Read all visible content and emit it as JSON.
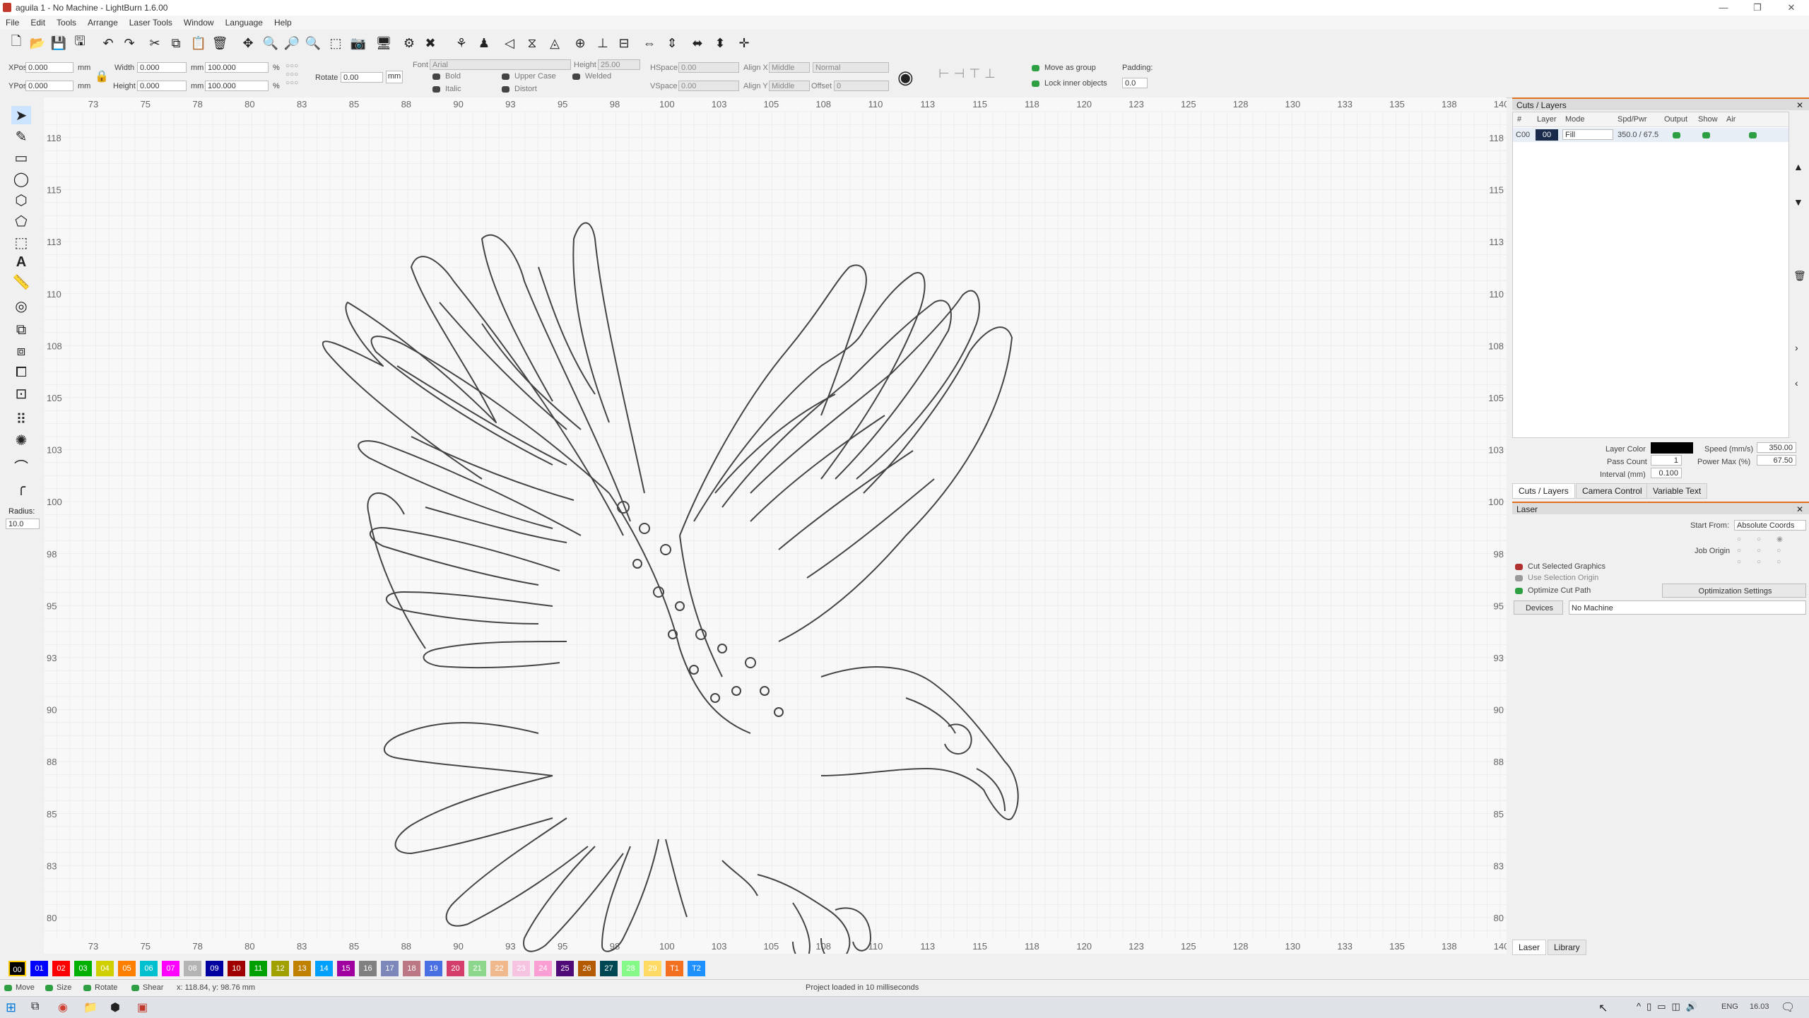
{
  "window": {
    "title": "aguila 1 - No Machine - LightBurn 1.6.00",
    "min": "—",
    "max": "❐",
    "close": "✕"
  },
  "menu": [
    "File",
    "Edit",
    "Tools",
    "Arrange",
    "Laser Tools",
    "Window",
    "Language",
    "Help"
  ],
  "options": {
    "xpos_label": "XPos",
    "xpos": "0.000",
    "ypos_label": "YPos",
    "ypos": "0.000",
    "unit_mm": "mm",
    "width_label": "Width",
    "width": "0.000",
    "height_label": "Height",
    "height": "0.000",
    "scale_w": "100.000",
    "scale_h": "100.000",
    "pct": "%",
    "rotate_label": "Rotate",
    "rotate": "0.00",
    "mm_btn": "mm",
    "font_label": "Font",
    "font": "Arial",
    "height2_label": "Height",
    "height2": "25.00",
    "hspace_label": "HSpace",
    "hspace": "0.00",
    "vspace_label": "VSpace",
    "vspace": "0.00",
    "alignx_label": "Align X",
    "alignx": "Middle",
    "aligny_label": "Align Y",
    "aligny": "Middle",
    "normal": "Normal",
    "offset_label": "Offset",
    "offset": "0",
    "bold": "Bold",
    "italic": "Italic",
    "upper": "Upper Case",
    "distort": "Distort",
    "welded": "Welded",
    "move_group": "Move as group",
    "lock_inner": "Lock inner objects",
    "padding_label": "Padding:",
    "padding": "0.0"
  },
  "left_tools": {
    "radius_label": "Radius:",
    "radius": "10.0"
  },
  "ruler": {
    "x_ticks": [
      "73",
      "75",
      "78",
      "80",
      "83",
      "85",
      "88",
      "90",
      "93",
      "95",
      "98",
      "100",
      "103",
      "105",
      "108",
      "110",
      "113",
      "115",
      "118",
      "120",
      "123",
      "125",
      "128",
      "130",
      "133",
      "135",
      "138",
      "140"
    ],
    "y_ticks": [
      "118",
      "115",
      "113",
      "110",
      "108",
      "105",
      "103",
      "100",
      "98",
      "95",
      "93",
      "90",
      "88",
      "85",
      "83",
      "80"
    ]
  },
  "cuts_panel": {
    "title": "Cuts / Layers",
    "headers": [
      "#",
      "Layer",
      "Mode",
      "Spd/Pwr",
      "Output",
      "Show",
      "Air"
    ],
    "row": {
      "num": "C00",
      "layer": "00",
      "mode": "Fill",
      "spdpwr": "350.0 / 67.5"
    },
    "layer_color_label": "Layer Color",
    "speed_label": "Speed (mm/s)",
    "speed": "350.00",
    "pass_label": "Pass Count",
    "pass": "1",
    "power_label": "Power Max (%)",
    "power": "67.50",
    "interval_label": "Interval (mm)",
    "interval": "0.100",
    "tabs": [
      "Cuts / Layers",
      "Camera Control",
      "Variable Text"
    ]
  },
  "laser_panel": {
    "title": "Laser",
    "start_from_label": "Start From:",
    "start_from": "Absolute Coords",
    "job_origin_label": "Job Origin",
    "cut_selected": "Cut Selected Graphics",
    "use_selection": "Use Selection Origin",
    "optimize": "Optimize Cut Path",
    "opt_settings": "Optimization Settings",
    "devices": "Devices",
    "machine": "No Machine",
    "tabs": [
      "Laser",
      "Library"
    ]
  },
  "palette": [
    {
      "l": "00",
      "c": "#000000"
    },
    {
      "l": "01",
      "c": "#0000ff"
    },
    {
      "l": "02",
      "c": "#ff0000"
    },
    {
      "l": "03",
      "c": "#00b000"
    },
    {
      "l": "04",
      "c": "#d0d000"
    },
    {
      "l": "05",
      "c": "#ff8000"
    },
    {
      "l": "06",
      "c": "#00c0d0"
    },
    {
      "l": "07",
      "c": "#ff00ff"
    },
    {
      "l": "08",
      "c": "#b4b4b4"
    },
    {
      "l": "09",
      "c": "#0000a0"
    },
    {
      "l": "10",
      "c": "#a00000"
    },
    {
      "l": "11",
      "c": "#00a000"
    },
    {
      "l": "12",
      "c": "#a0a000"
    },
    {
      "l": "13",
      "c": "#c08000"
    },
    {
      "l": "14",
      "c": "#00a0ff"
    },
    {
      "l": "15",
      "c": "#a000a0"
    },
    {
      "l": "16",
      "c": "#808080"
    },
    {
      "l": "17",
      "c": "#7d87b9"
    },
    {
      "l": "18",
      "c": "#bb7784"
    },
    {
      "l": "19",
      "c": "#4a6fe3"
    },
    {
      "l": "20",
      "c": "#d33f6a"
    },
    {
      "l": "21",
      "c": "#8cd78c"
    },
    {
      "l": "22",
      "c": "#f0b98d"
    },
    {
      "l": "23",
      "c": "#f6c4e1"
    },
    {
      "l": "24",
      "c": "#fa9ed4"
    },
    {
      "l": "25",
      "c": "#500a78"
    },
    {
      "l": "26",
      "c": "#b45a00"
    },
    {
      "l": "27",
      "c": "#004754"
    },
    {
      "l": "28",
      "c": "#86fa88"
    },
    {
      "l": "29",
      "c": "#ffdb66"
    },
    {
      "l": "T1",
      "c": "#f37021"
    },
    {
      "l": "T2",
      "c": "#1e90ff"
    }
  ],
  "status": {
    "move": "Move",
    "size": "Size",
    "rotate": "Rotate",
    "shear": "Shear",
    "coords": "x: 118.84, y: 98.76 mm",
    "message": "Project loaded in 10 milliseconds"
  },
  "taskbar": {
    "lang": "ENG",
    "time": "16.03"
  }
}
